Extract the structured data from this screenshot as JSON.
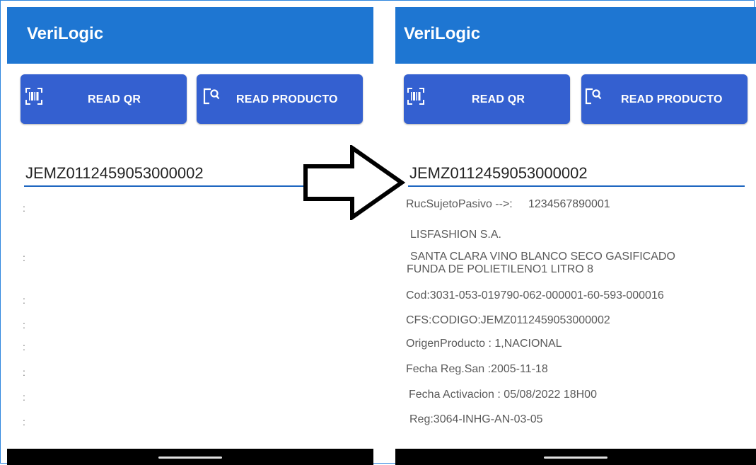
{
  "app": {
    "title": "VeriLogic"
  },
  "buttons": {
    "read_qr": "READ QR",
    "read_producto": "READ PRODUCTO"
  },
  "left": {
    "code_value": "JEMZ0112459053000002",
    "colon": ":"
  },
  "right": {
    "code_value": "JEMZ0112459053000002",
    "ruc_label": "RucSujetoPasivo -->:",
    "ruc_value": "1234567890001",
    "company": "LISFASHION S.A.",
    "product_line1": "SANTA CLARA VINO BLANCO SECO GASIFICADO",
    "product_line2": "FUNDA DE POLIETILENO1 LITRO 8",
    "cod": "Cod:3031-053-019790-062-000001-60-593-000016",
    "cfs": "CFS:CODIGO:JEMZ0112459053000002",
    "origen": "OrigenProducto : 1,NACIONAL",
    "fecha_reg": "Fecha Reg.San :2005-11-18",
    "fecha_activacion": "Fecha Activacion : 05/08/2022 18H00",
    "reg": "Reg:3064-INHG-AN-03-05"
  },
  "icons": {
    "qr": "barcode-scan-icon",
    "product": "product-search-icon",
    "arrow": "right-arrow-icon"
  },
  "colors": {
    "appbar": "#1e76d2",
    "button": "#3460d0",
    "underline": "#1e66c0"
  }
}
